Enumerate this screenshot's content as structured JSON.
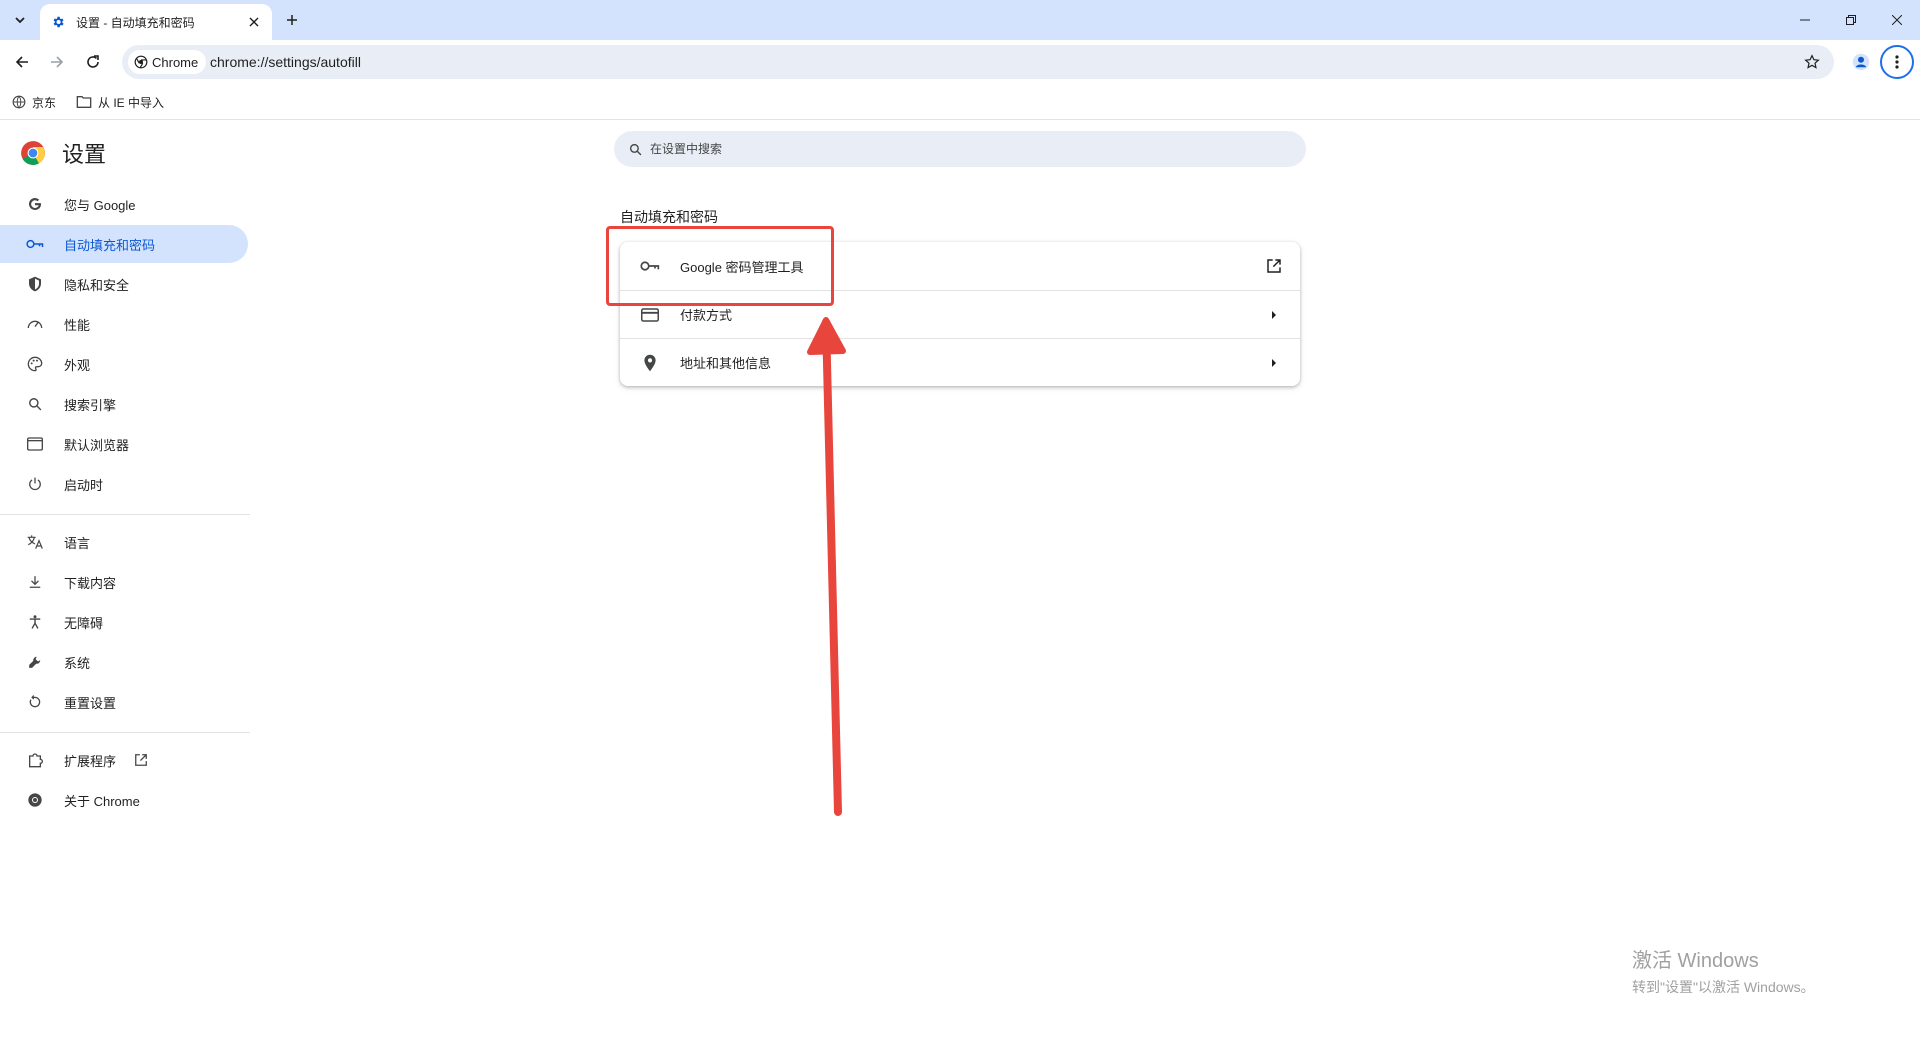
{
  "browser": {
    "tab_title": "设置 - 自动填充和密码",
    "chip_label": "Chrome",
    "url": "chrome://settings/autofill",
    "bookmarks": [
      "京东",
      "从 IE 中导入"
    ]
  },
  "sidebar": {
    "title": "设置",
    "items": [
      {
        "label": "您与 Google",
        "icon": "google-g-icon"
      },
      {
        "label": "自动填充和密码",
        "icon": "key-icon",
        "active": true
      },
      {
        "label": "隐私和安全",
        "icon": "shield-icon"
      },
      {
        "label": "性能",
        "icon": "speedometer-icon"
      },
      {
        "label": "外观",
        "icon": "palette-icon"
      },
      {
        "label": "搜索引擎",
        "icon": "search-icon"
      },
      {
        "label": "默认浏览器",
        "icon": "browser-window-icon"
      },
      {
        "label": "启动时",
        "icon": "power-icon"
      },
      {
        "label": "语言",
        "icon": "translate-icon"
      },
      {
        "label": "下载内容",
        "icon": "download-icon"
      },
      {
        "label": "无障碍",
        "icon": "accessibility-icon"
      },
      {
        "label": "系统",
        "icon": "wrench-icon"
      },
      {
        "label": "重置设置",
        "icon": "reset-icon"
      },
      {
        "label": "扩展程序",
        "icon": "puzzle-icon"
      },
      {
        "label": "关于 Chrome",
        "icon": "chrome-icon"
      }
    ]
  },
  "main": {
    "search_placeholder": "在设置中搜索",
    "section_title": "自动填充和密码",
    "rows": [
      {
        "label": "Google 密码管理工具",
        "icon": "key-icon",
        "end": "open-in-new-icon"
      },
      {
        "label": "付款方式",
        "icon": "credit-card-icon",
        "end": "arrow-right-icon"
      },
      {
        "label": "地址和其他信息",
        "icon": "location-pin-icon",
        "end": "arrow-right-icon"
      }
    ]
  },
  "watermark": {
    "title": "激活 Windows",
    "subtitle": "转到\"设置\"以激活 Windows。"
  },
  "colors": {
    "accent": "#0b57d0",
    "active_bg": "#d3e3fd",
    "annotation": "#e8453c"
  }
}
